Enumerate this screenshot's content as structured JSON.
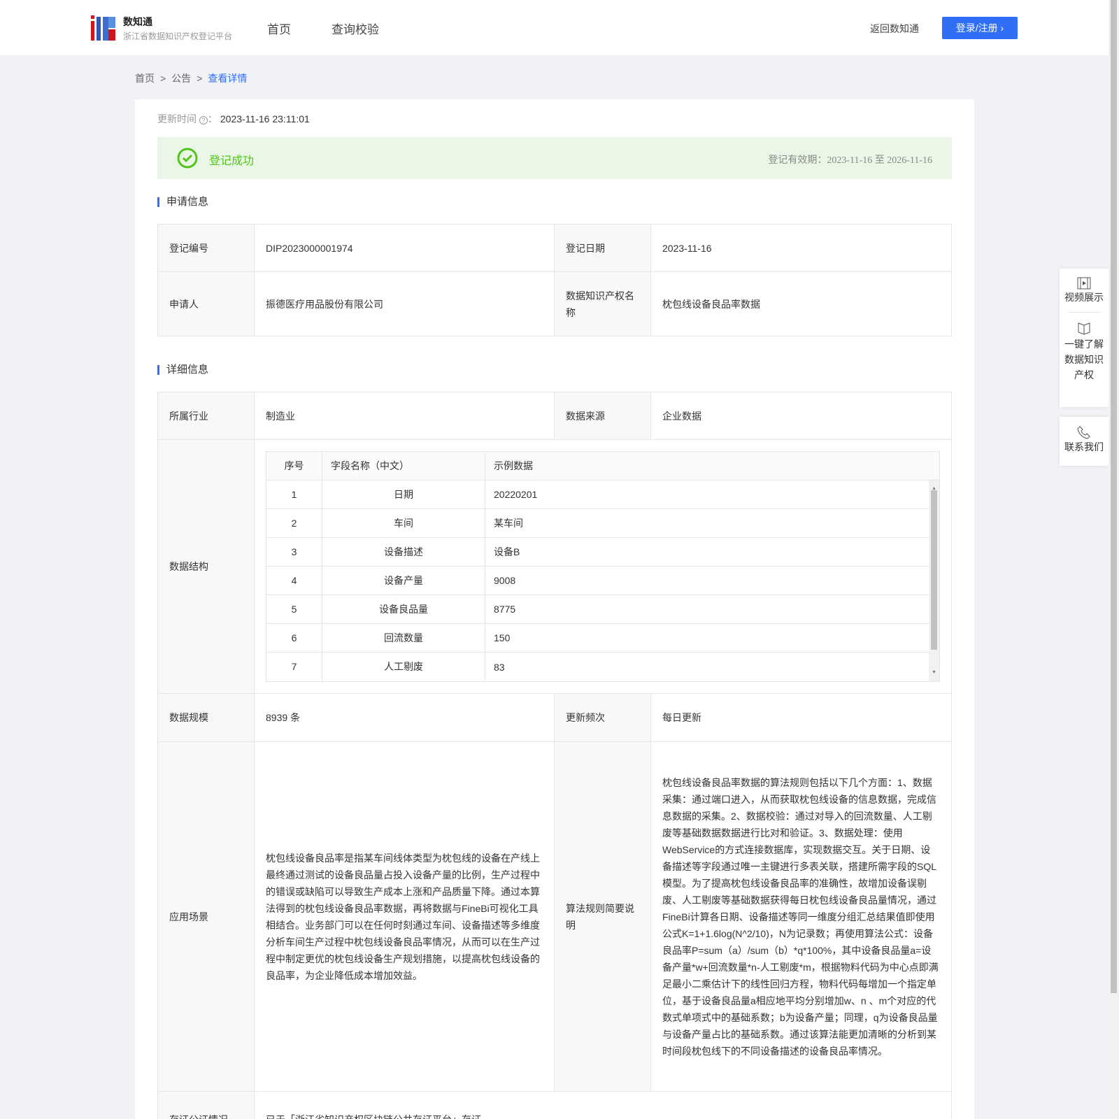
{
  "header": {
    "brand": "数知通",
    "subtitle": "浙江省数据知识产权登记平台",
    "nav": [
      "首页",
      "查询校验"
    ],
    "back_label": "返回数知通",
    "login_label": "登录/注册 ›"
  },
  "breadcrumb": [
    "首页",
    "公告",
    "查看详情"
  ],
  "update": {
    "label": "更新时间",
    "value": "2023-11-16 23:11:01"
  },
  "status": {
    "text": "登记成功",
    "validity": "登记有效期：2023-11-16 至 2026-11-16",
    "color": "#52c41a"
  },
  "apply": {
    "title": "申请信息",
    "reg_no_label": "登记编号",
    "reg_no": "DIP2023000001974",
    "reg_date_label": "登记日期",
    "reg_date": "2023-11-16",
    "applicant_label": "申请人",
    "applicant": "振德医疗用品股份有限公司",
    "name_label": "数据知识产权名称",
    "name": "枕包线设备良品率数据"
  },
  "detail": {
    "title": "详细信息",
    "industry_label": "所属行业",
    "industry": "制造业",
    "source_label": "数据来源",
    "source": "企业数据",
    "structure_label": "数据结构",
    "columns": [
      "序号",
      "字段名称（中文）",
      "示例数据"
    ],
    "rows": [
      [
        "1",
        "日期",
        "20220201"
      ],
      [
        "2",
        "车间",
        "某车间"
      ],
      [
        "3",
        "设备描述",
        "设备B"
      ],
      [
        "4",
        "设备产量",
        "9008"
      ],
      [
        "5",
        "设备良品量",
        "8775"
      ],
      [
        "6",
        "回流数量",
        "150"
      ],
      [
        "7",
        "人工剔废",
        "83"
      ]
    ],
    "scale_label": "数据规模",
    "scale": "8939 条",
    "freq_label": "更新频次",
    "freq": "每日更新",
    "scene_label": "应用场景",
    "scene": "枕包线设备良品率是指某车间线体类型为枕包线的设备在产线上最终通过测试的设备良品量占投入设备产量的比例，生产过程中的错误或缺陷可以导致生产成本上涨和产品质量下降。通过本算法得到的枕包线设备良品率数据，再将数据与FineBi可视化工具相结合。业务部门可以在任何时刻通过车间、设备描述等多维度分析车间生产过程中枕包线设备良品率情况，从而可以在生产过程中制定更优的枕包线设备生产规划措施，以提高枕包线设备的良品率，为企业降低成本增加效益。",
    "algo_label": "算法规则简要说明",
    "algo": "枕包线设备良品率数据的算法规则包括以下几个方面：1、数据采集：通过端口进入，从而获取枕包线设备的信息数据，完成信息数据的采集。2、数据校验：通过对导入的回流数量、人工剔废等基础数据数据进行比对和验证。3、数据处理：使用WebService的方式连接数据库，实现数据交互。关于日期、设备描述等字段通过唯一主键进行多表关联，搭建所需字段的SQL模型。为了提高枕包线设备良品率的准确性，故增加设备误剔废、人工剔废等基础数据获得每日枕包线设备良品量情况，通过FineBi计算各日期、设备描述等同一维度分组汇总结果值即使用公式K=1+1.6log(N^2/10)，N为记录数；再使用算法公式：设备良品率P=sum（a）/sum（b）*q*100%，其中设备良品量a=设备产量*w+回流数量*n-人工剔废*m，根据物料代码为中心点即满足最小二乘估计下的线性回归方程，物料代码每增加一个指定单位，基于设备良品量a相应地平均分别增加w、n 、m个对应的代数式单项式中的基础系数；b为设备产量；同理，q为设备良品量与设备产量占比的基础系数。通过该算法能更加清晰的分析到某时间段枕包线下的不同设备描述的设备良品率情况。",
    "cert_label": "存证公证情况",
    "cert": "已于「浙江省知识产权区块链公共存证平台」存证"
  },
  "sidebar": [
    "视频展示",
    "一键了解数据知识产权",
    "联系我们"
  ]
}
